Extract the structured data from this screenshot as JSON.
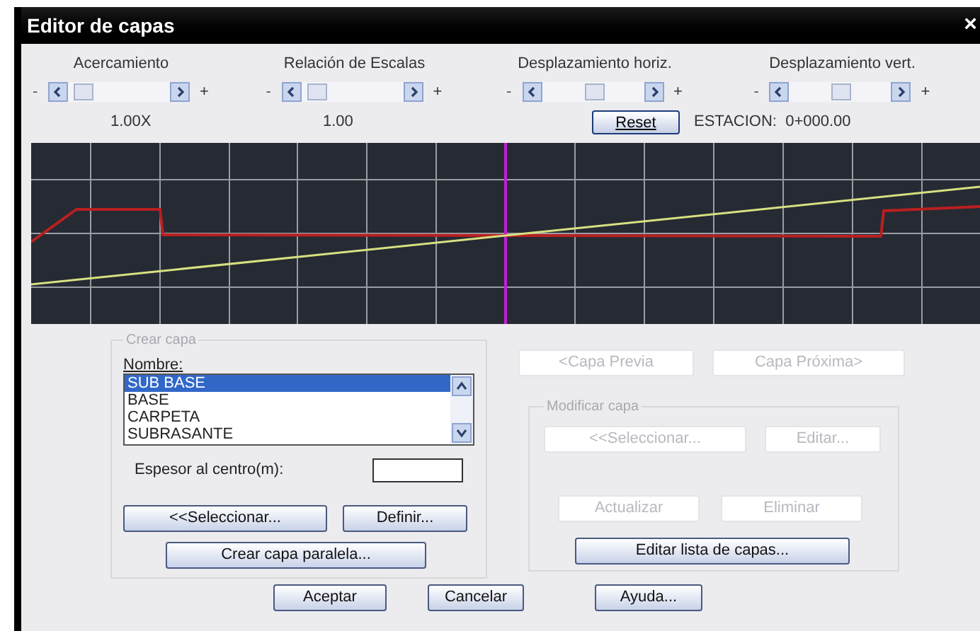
{
  "window": {
    "title": "Editor de capas",
    "close": "×"
  },
  "scrollers": [
    {
      "label": "Acercamiento",
      "minus": "-",
      "plus": "+"
    },
    {
      "label": "Relación de Escalas",
      "minus": "-",
      "plus": "+"
    },
    {
      "label": "Desplazamiento horiz.",
      "minus": "-",
      "plus": "+"
    },
    {
      "label": "Desplazamiento vert.",
      "minus": "-",
      "plus": "+"
    }
  ],
  "readouts": {
    "zoom": "1.00X",
    "scale": "1.00",
    "reset_button": "Reset",
    "station": "ESTACION:  0+000.00"
  },
  "create_group": {
    "title": "Crear capa",
    "name_label": "Nombre:",
    "layers": [
      {
        "label": "SUB BASE",
        "selected": true
      },
      {
        "label": "BASE",
        "selected": false
      },
      {
        "label": "CARPETA",
        "selected": false
      },
      {
        "label": "SUBRASANTE",
        "selected": false
      }
    ],
    "thickness_label": "Espesor al centro(m):",
    "buttons": [
      {
        "label": "<<Seleccionar...",
        "disabled": false
      },
      {
        "label": "Definir...",
        "disabled": false
      }
    ],
    "parallel_button": {
      "label": "Crear capa paralela...",
      "disabled": false
    }
  },
  "nav_buttons": [
    {
      "label": "<Capa Previa",
      "disabled": true
    },
    {
      "label": "Capa Próxima>",
      "disabled": true
    }
  ],
  "modify_group": {
    "title": "Modificar capa",
    "row1": [
      {
        "label": "<<Seleccionar...",
        "disabled": true
      },
      {
        "label": "Editar...",
        "disabled": true
      }
    ],
    "row2": [
      {
        "label": "Actualizar",
        "disabled": true
      },
      {
        "label": "Eliminar",
        "disabled": true
      }
    ],
    "list_button": {
      "label": "Editar lista de capas...",
      "disabled": false
    }
  },
  "footer_buttons": [
    {
      "label": "Aceptar",
      "disabled": false
    },
    {
      "label": "Cancelar",
      "disabled": false
    },
    {
      "label": "Ayuda...",
      "disabled": false
    }
  ]
}
